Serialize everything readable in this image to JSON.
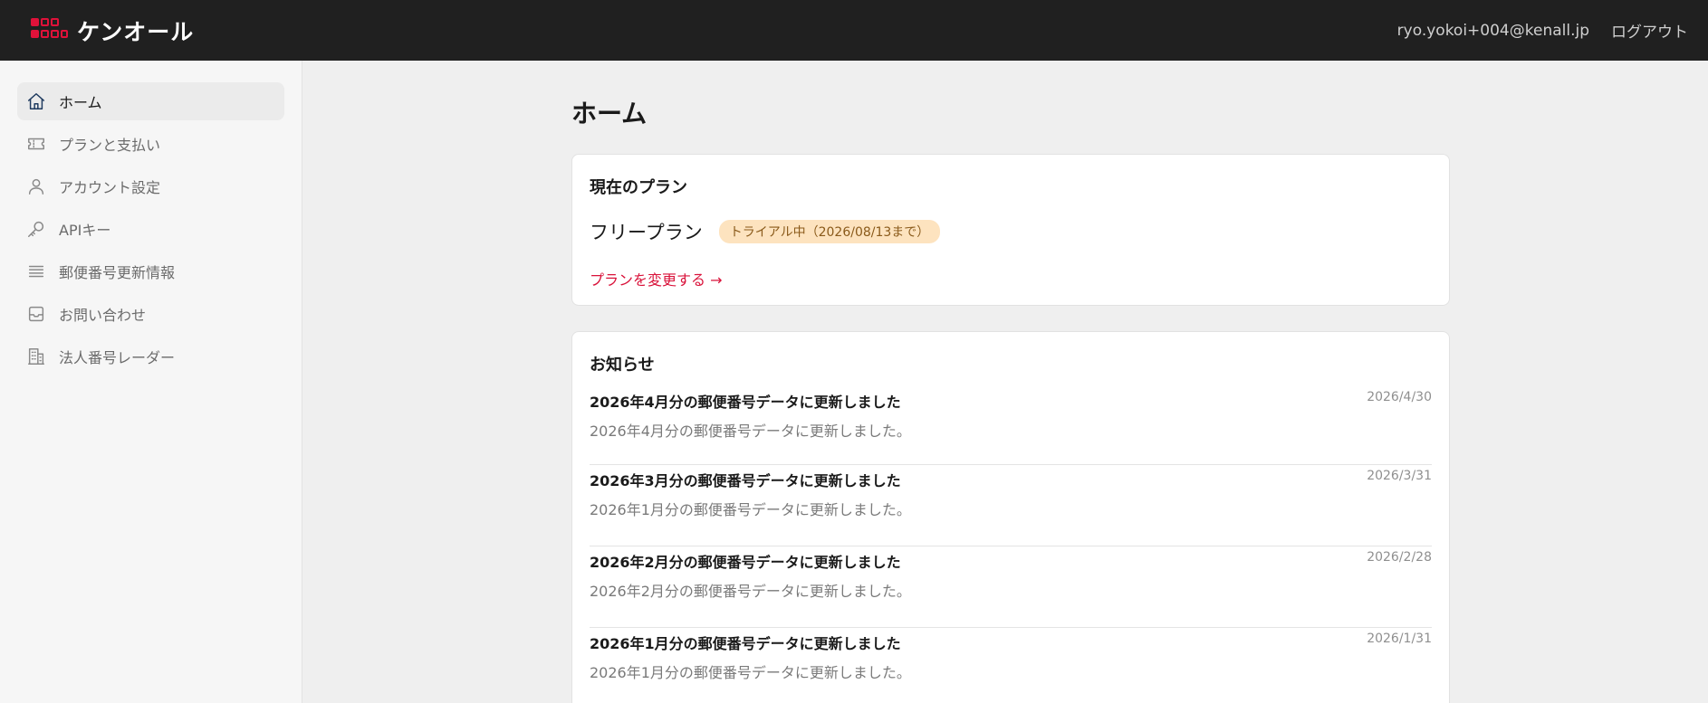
{
  "header": {
    "brand": "ケンオール",
    "user_email": "ryo.yokoi+004@kenall.jp",
    "logout": "ログアウト"
  },
  "sidebar": {
    "items": [
      {
        "label": "ホーム",
        "icon": "home-icon"
      },
      {
        "label": "プランと支払い",
        "icon": "ticket-icon"
      },
      {
        "label": "アカウント設定",
        "icon": "user-icon"
      },
      {
        "label": "APIキー",
        "icon": "key-icon"
      },
      {
        "label": "郵便番号更新情報",
        "icon": "list-icon"
      },
      {
        "label": "お問い合わせ",
        "icon": "inbox-icon"
      },
      {
        "label": "法人番号レーダー",
        "icon": "building-icon"
      }
    ]
  },
  "main": {
    "title": "ホーム",
    "plan_card": {
      "title": "現在のプラン",
      "plan_name": "フリープラン",
      "badge": "トライアル中（2026/08/13まで）",
      "change_link": "プランを変更する →"
    },
    "news_card": {
      "title": "お知らせ",
      "items": [
        {
          "title": "2026年4月分の郵便番号データに更新しました",
          "desc": "2026年4月分の郵便番号データに更新しました。",
          "date": "2026/4/30"
        },
        {
          "title": "2026年3月分の郵便番号データに更新しました",
          "desc": "2026年1月分の郵便番号データに更新しました。",
          "date": "2026/3/31"
        },
        {
          "title": "2026年2月分の郵便番号データに更新しました",
          "desc": "2026年2月分の郵便番号データに更新しました。",
          "date": "2026/2/28"
        },
        {
          "title": "2026年1月分の郵便番号データに更新しました",
          "desc": "2026年1月分の郵便番号データに更新しました。",
          "date": "2026/1/31"
        }
      ]
    }
  },
  "colors": {
    "header_bg": "#202020",
    "brand_red": "#e0123a",
    "link_red": "#d9123a",
    "badge_bg": "#fde3bf"
  }
}
